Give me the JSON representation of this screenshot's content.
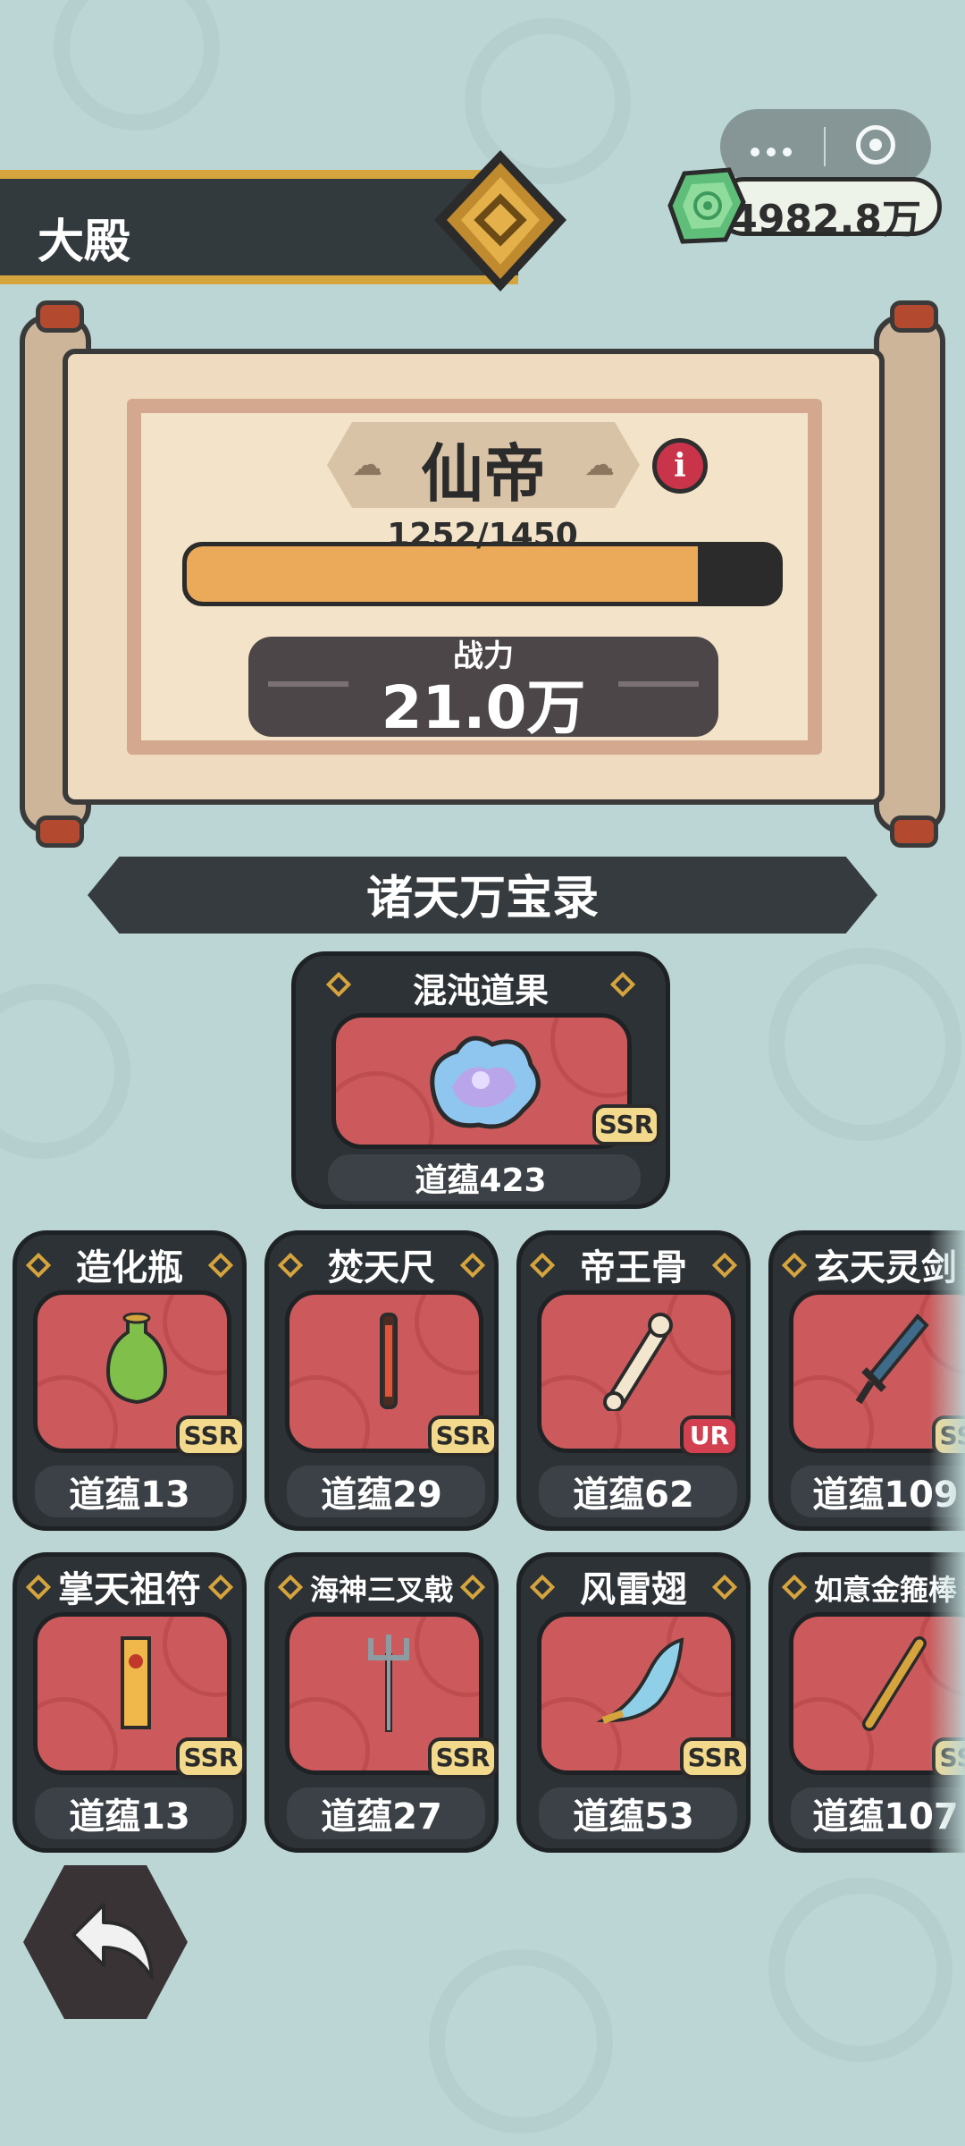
{
  "header": {
    "title": "大殿",
    "currency_value": "4982.8万"
  },
  "capsule": {
    "more_icon": "more-dots-icon",
    "close_icon": "target-icon"
  },
  "rank": {
    "name": "仙帝",
    "info_icon": "info-icon",
    "exp_text": "1252/1450",
    "exp_current": 1252,
    "exp_max": 1450,
    "power_label": "战力",
    "power_value": "21.0万"
  },
  "section": {
    "title": "诸天万宝录"
  },
  "featured": {
    "name": "混沌道果",
    "rarity": "SSR",
    "value": "道蕴423"
  },
  "items": [
    {
      "name": "造化瓶",
      "rarity": "SSR",
      "value": "道蕴13"
    },
    {
      "name": "焚天尺",
      "rarity": "SSR",
      "value": "道蕴29"
    },
    {
      "name": "帝王骨",
      "rarity": "UR",
      "value": "道蕴62"
    },
    {
      "name": "玄天灵剑",
      "rarity": "SSR",
      "value": "道蕴109"
    },
    {
      "name": "掌天祖符",
      "rarity": "SSR",
      "value": "道蕴13"
    },
    {
      "name": "海神三叉戟",
      "rarity": "SSR",
      "value": "道蕴27"
    },
    {
      "name": "风雷翅",
      "rarity": "SSR",
      "value": "道蕴53"
    },
    {
      "name": "如意金箍棒",
      "rarity": "SSR",
      "value": "道蕴107"
    }
  ],
  "colors": {
    "background": "#bcd6d6",
    "gold": "#d6a43d",
    "card_red": "#cc5a5c",
    "bar_fill": "#eba95a"
  }
}
